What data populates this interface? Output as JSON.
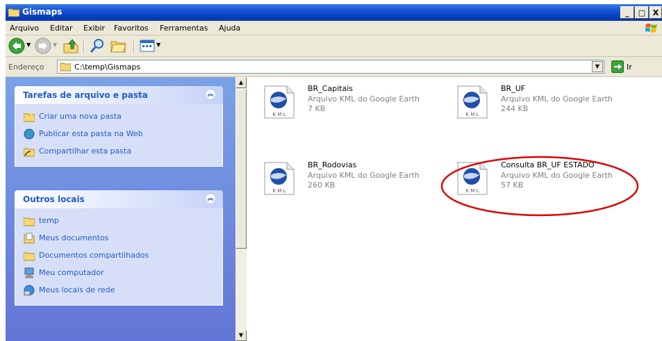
{
  "window": {
    "title": "Gismaps"
  },
  "titlebar_buttons": {
    "minimize": "_",
    "maximize": "□",
    "close": "X"
  },
  "menu": [
    "Arquivo",
    "Editar",
    "Exibir",
    "Favoritos",
    "Ferramentas",
    "Ajuda"
  ],
  "address": {
    "label": "Endereço",
    "path": "C:\\temp\\Gismaps",
    "go_label": "Ir"
  },
  "tasks_panel": {
    "title": "Tarefas de arquivo e pasta",
    "items": [
      {
        "label": "Criar uma nova pasta",
        "icon": "new-folder-icon"
      },
      {
        "label": "Publicar esta pasta na Web",
        "icon": "publish-web-icon"
      },
      {
        "label": "Compartilhar esta pasta",
        "icon": "share-folder-icon"
      }
    ]
  },
  "places_panel": {
    "title": "Outros locais",
    "items": [
      {
        "label": "temp",
        "icon": "folder-icon"
      },
      {
        "label": "Meus documentos",
        "icon": "my-documents-icon"
      },
      {
        "label": "Documentos compartilhados",
        "icon": "folder-icon"
      },
      {
        "label": "Meu computador",
        "icon": "my-computer-icon"
      },
      {
        "label": "Meus locais de rede",
        "icon": "network-places-icon"
      }
    ]
  },
  "files": [
    {
      "name": "BR_Capitais",
      "type": "Arquivo KML do Google Earth",
      "size": "7 KB",
      "icon": "kml-file-icon"
    },
    {
      "name": "BR_UF",
      "type": "Arquivo KML do Google Earth",
      "size": "244 KB",
      "icon": "kml-file-icon"
    },
    {
      "name": "BR_Rodovias",
      "type": "Arquivo KML do Google Earth",
      "size": "260 KB",
      "icon": "kml-file-icon"
    },
    {
      "name": "Consulta BR_UF ESTADO",
      "type": "Arquivo KML do Google Earth",
      "size": "57 KB",
      "icon": "kml-file-icon",
      "highlighted": true
    }
  ],
  "kml_icon_text": "K M L",
  "colors": {
    "highlight_ellipse": "#e00000",
    "task_link": "#215dc6",
    "title_bar": "#0a3fbd"
  }
}
